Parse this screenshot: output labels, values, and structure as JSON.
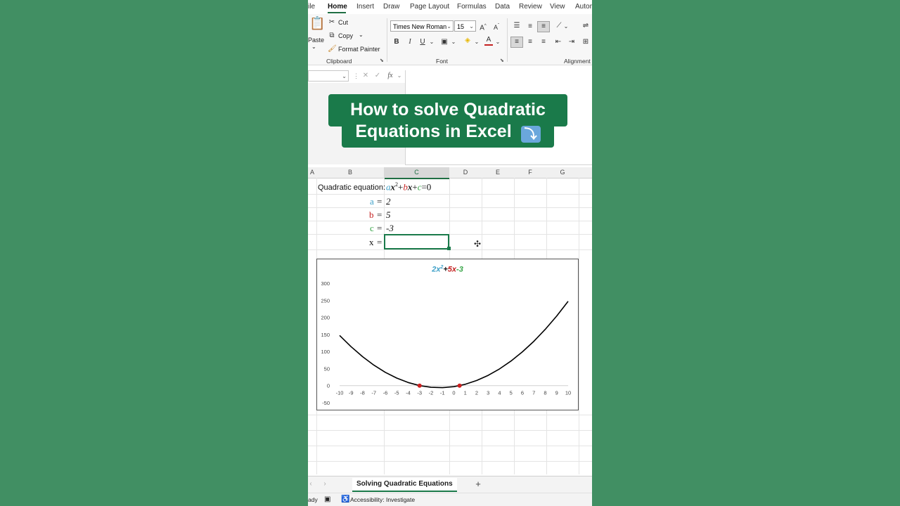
{
  "ribbon_tabs": [
    "ile",
    "Home",
    "Insert",
    "Draw",
    "Page Layout",
    "Formulas",
    "Data",
    "Review",
    "View",
    "Autom"
  ],
  "clipboard": {
    "paste": "Paste",
    "cut": "Cut",
    "copy": "Copy",
    "format_painter": "Format Painter",
    "group_label": "Clipboard"
  },
  "font": {
    "family": "Times New Roman",
    "size": "15",
    "bold": "B",
    "italic": "I",
    "underline": "U",
    "group_label": "Font"
  },
  "alignment": {
    "group_label": "Alignment"
  },
  "formula_bar": {
    "fx": "fx"
  },
  "banner": {
    "line1": "How to solve Quadratic",
    "line2": "Equations in Excel",
    "emoji": "⤵️"
  },
  "columns": [
    "A",
    "B",
    "C",
    "D",
    "E",
    "F",
    "G"
  ],
  "cells": {
    "quadratic_label": "Quadratic equation:",
    "eq": {
      "a": "a",
      "x1": "x",
      "sup": "2",
      "plus1": "+",
      "b": "b",
      "x2": "x",
      "plus2": "+",
      "c": "c",
      "tail": "=0"
    },
    "a_label": "a",
    "b_label": "b",
    "c_label": "c",
    "x_label": "x",
    "eq_sign": "=",
    "a_value": "2",
    "b_value": "5",
    "c_value": "-3"
  },
  "chart_title": {
    "a": "2",
    "x": "x",
    "sup": "2",
    "plus": "+",
    "b": "5",
    "bx": "x",
    "c": "-3"
  },
  "chart_data": {
    "type": "line",
    "x": [
      -10,
      -9,
      -8,
      -7,
      -6,
      -5,
      -4,
      -3,
      -2,
      -1,
      0,
      1,
      2,
      3,
      4,
      5,
      6,
      7,
      8,
      9,
      10
    ],
    "series": [
      {
        "values": [
          147,
          114,
          85,
          60,
          39,
          22,
          9,
          0,
          -5,
          -6,
          -3,
          4,
          15,
          30,
          49,
          72,
          99,
          130,
          165,
          204,
          247
        ]
      }
    ],
    "points": [
      {
        "x": -3,
        "y": 0
      },
      {
        "x": 0.5,
        "y": 0
      }
    ],
    "xticks": [
      -10,
      -9,
      -8,
      -7,
      -6,
      -5,
      -4,
      -3,
      -2,
      -1,
      0,
      1,
      2,
      3,
      4,
      5,
      6,
      7,
      8,
      9,
      10
    ],
    "yticks": [
      -50,
      0,
      50,
      100,
      150,
      200,
      250,
      300
    ],
    "xlim": [
      -10,
      10
    ],
    "ylim": [
      -50,
      300
    ],
    "grid": false,
    "colors": {
      "line": "#000000",
      "roots": "#cc1f1f"
    }
  },
  "colors": {
    "a": "#3ea0c8",
    "b": "#c42020",
    "c": "#3aa64a",
    "excel_green": "#1a7a4a"
  },
  "sheet_tab": "Solving Quadratic Equations",
  "status": {
    "ready": "ady",
    "accessibility": "Accessibility: Investigate"
  }
}
